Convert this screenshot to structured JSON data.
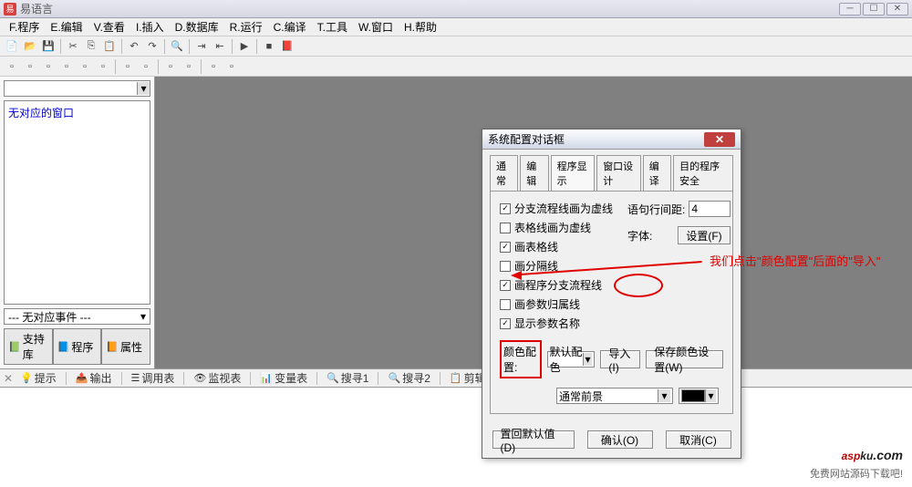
{
  "app": {
    "title": "易语言",
    "icon_text": "易"
  },
  "menu": {
    "items": [
      "F.程序",
      "E.编辑",
      "V.查看",
      "I.插入",
      "D.数据库",
      "R.运行",
      "C.编译",
      "T.工具",
      "W.窗口",
      "H.帮助"
    ]
  },
  "sidebar": {
    "tree_text": "无对应的窗口",
    "bottom_combo": "--- 无对应事件 ---",
    "tabs": [
      "支持库",
      "程序",
      "属性"
    ]
  },
  "dialog": {
    "title": "系统配置对话框",
    "tabs": [
      "通常",
      "编辑",
      "程序显示",
      "窗口设计",
      "编译",
      "目的程序安全"
    ],
    "active_tab": 2,
    "checkboxes": [
      {
        "label": "分支流程线画为虚线",
        "checked": true
      },
      {
        "label": "表格线画为虚线",
        "checked": false
      },
      {
        "label": "画表格线",
        "checked": true
      },
      {
        "label": "画分隔线",
        "checked": false
      },
      {
        "label": "画程序分支流程线",
        "checked": true
      },
      {
        "label": "画参数归属线",
        "checked": false
      },
      {
        "label": "显示参数名称",
        "checked": true
      }
    ],
    "right": {
      "line_spacing_label": "语句行间距:",
      "line_spacing_value": "4",
      "font_label": "字体:",
      "font_button": "设置(F)"
    },
    "color_config": {
      "label": "颜色配置:",
      "scheme": "默认配色",
      "import_btn": "导入(I)",
      "save_btn": "保存颜色设置(W)",
      "fg_label": "通常前景"
    },
    "buttons": {
      "reset": "置回默认值(D)",
      "ok": "确认(O)",
      "cancel": "取消(C)"
    }
  },
  "annotation": {
    "text": "我们点击\"颜色配置\"后面的\"导入\""
  },
  "bottom_tabs": [
    "提示",
    "输出",
    "调用表",
    "监视表",
    "变量表",
    "搜寻1",
    "搜寻2",
    "剪辑历史"
  ],
  "watermark": {
    "logo1": "asp",
    "logo2": "ku",
    "logo3": ".com",
    "sub": "免费网站源码下载吧!"
  }
}
